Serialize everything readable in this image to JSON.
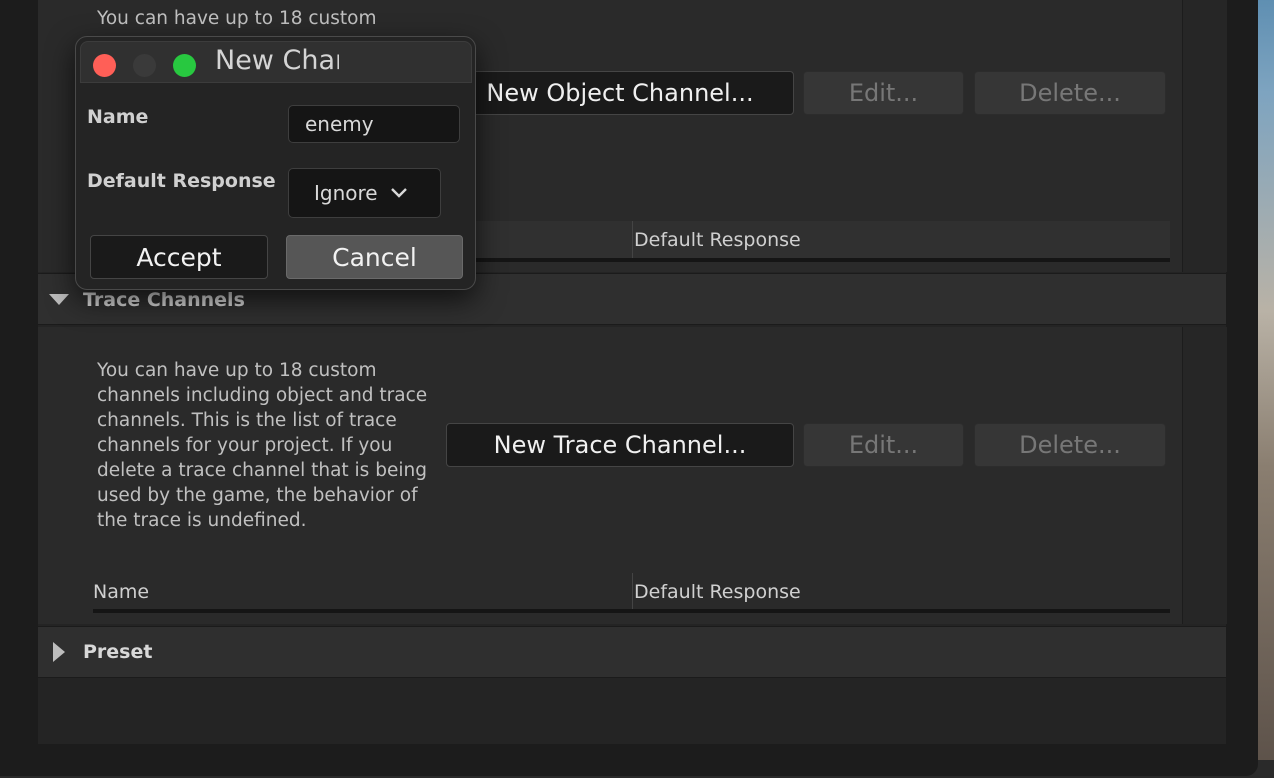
{
  "object_channels": {
    "description": "You can have up to 18 custom",
    "new_button": "New Object Channel...",
    "edit_button": "Edit...",
    "delete_button": "Delete...",
    "col_response": "Default Response"
  },
  "trace_channels": {
    "title": "Trace Channels",
    "description": "You can have up to 18 custom channels including object and trace channels. This is the list of trace channels for your project. If you delete a trace channel that is being used by the game, the behavior of the trace is undefined.",
    "new_button": "New Trace Channel...",
    "edit_button": "Edit...",
    "delete_button": "Delete...",
    "col_name": "Name",
    "col_response": "Default Response"
  },
  "preset": {
    "title": "Preset"
  },
  "dialog": {
    "title": "New Chan",
    "name_label": "Name",
    "name_value": "enemy",
    "response_label": "Default Response",
    "response_value": "Ignore",
    "accept_button": "Accept",
    "cancel_button": "Cancel",
    "traffic_lights": {
      "close": "#ff5f57",
      "minimize": "#3a3a3a",
      "zoom": "#28c840"
    }
  }
}
